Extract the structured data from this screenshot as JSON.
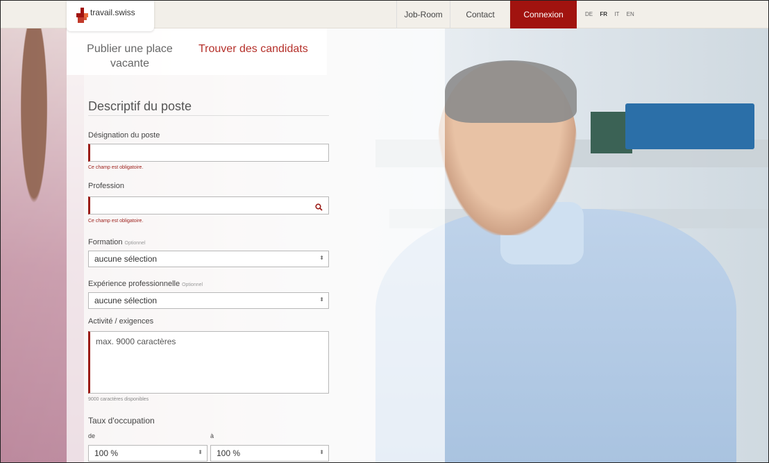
{
  "header": {
    "logo_text": "travail.swiss",
    "nav": {
      "job_room": "Job-Room",
      "contact": "Contact",
      "login": "Connexion"
    },
    "languages": [
      "DE",
      "FR",
      "IT",
      "EN"
    ],
    "active_language": "FR"
  },
  "tabs": {
    "publish": "Publier une place vacante",
    "find": "Trouver des candidats"
  },
  "form": {
    "section_title": "Descriptif du poste",
    "job_title_label": "Désignation du poste",
    "job_title_value": "",
    "job_title_error": "Ce champ est obligatoire.",
    "profession_label": "Profession",
    "profession_value": "",
    "profession_error": "Ce champ est obligatoire.",
    "education_label": "Formation",
    "education_optional": "Optionnel",
    "education_value": "aucune sélection",
    "experience_label": "Expérience professionnelle",
    "experience_optional": "Optionnel",
    "experience_value": "aucune sélection",
    "activity_label": "Activité / exigences",
    "activity_placeholder": "max. 9000 caractères",
    "activity_hint": "9000 caractères disponibles",
    "workload_label": "Taux d'occupation",
    "from_label": "de",
    "to_label": "à",
    "from_value": "100 %",
    "to_value": "100 %"
  },
  "colors": {
    "brand_red": "#a1130f",
    "error_red": "#9b1c17",
    "tab_active": "#b5302a"
  }
}
